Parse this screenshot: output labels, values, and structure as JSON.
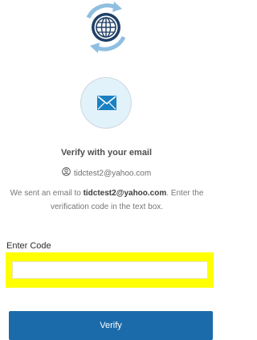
{
  "header": {
    "logo_icon": "globe-sync-icon"
  },
  "factor": {
    "icon": "envelope-icon"
  },
  "title": "Verify with your email",
  "identifier": {
    "icon": "user-icon",
    "email": "tidctest2@yahoo.com"
  },
  "instructions": {
    "prefix": "We sent an email to ",
    "email": "tidctest2@yahoo.com",
    "suffix": ". Enter the verification code in the text box."
  },
  "form": {
    "code_label": "Enter Code",
    "code_value": "",
    "verify_label": "Verify"
  },
  "colors": {
    "primary": "#1b6bab",
    "highlight": "#ffff00",
    "icon_circle": "#e2f2fb",
    "icon_blue": "#1a80c2"
  }
}
